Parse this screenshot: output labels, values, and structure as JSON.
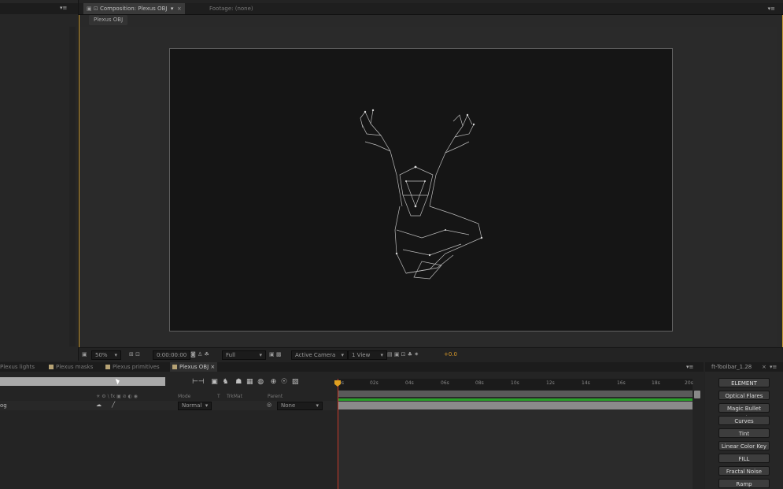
{
  "composition_panel": {
    "tab_label": "Composition: Plexus OBJ",
    "footage_tab_label": "Footage: (none)",
    "subtab_label": "Plexus OBJ",
    "menu_glyph": "▾≡"
  },
  "viewer_bar": {
    "zoom": "50%",
    "timecode": "0:00:00:00",
    "resolution": "Full",
    "camera": "Active Camera",
    "views": "1 View",
    "exposure": "+0.0"
  },
  "timeline": {
    "tabs": [
      {
        "label": "Plexus lights"
      },
      {
        "label": "Plexus masks"
      },
      {
        "label": "Plexus primitives"
      },
      {
        "label": "Plexus OBJ"
      }
    ],
    "close_glyph": "×",
    "switch_headers": "☀ ⚙ \\ fx ▣ ⊘ ◐ ◉",
    "columns": {
      "mode": "Mode",
      "t": "T",
      "trkmat": "TrkMat",
      "parent": "Parent"
    },
    "layer": {
      "name": "og",
      "mode": "Normal",
      "parent": "None"
    },
    "ruler_ticks": [
      "0s",
      "02s",
      "04s",
      "06s",
      "08s",
      "10s",
      "12s",
      "14s",
      "16s",
      "18s",
      "20s"
    ]
  },
  "ft_toolbar": {
    "title": "ft-Toolbar_1.28",
    "buttons": [
      "ELEMENT",
      "Optical Flares",
      "Magic Bullet Looks",
      "Curves",
      "Tint",
      "Linear Color Key",
      "FILL",
      "Fractal Noise",
      "Ramp"
    ]
  },
  "colors": {
    "accent": "#c89a34",
    "playhead": "#c83a2a",
    "work_area_green": "#2aa02a",
    "tab_swatch": "#b6a274"
  },
  "icons": [
    "snapshot-icon",
    "region-icon",
    "grid-icon",
    "transparency-icon",
    "fast-preview-icon",
    "flowchart-icon",
    "exposure-icon",
    "menu-icon"
  ]
}
